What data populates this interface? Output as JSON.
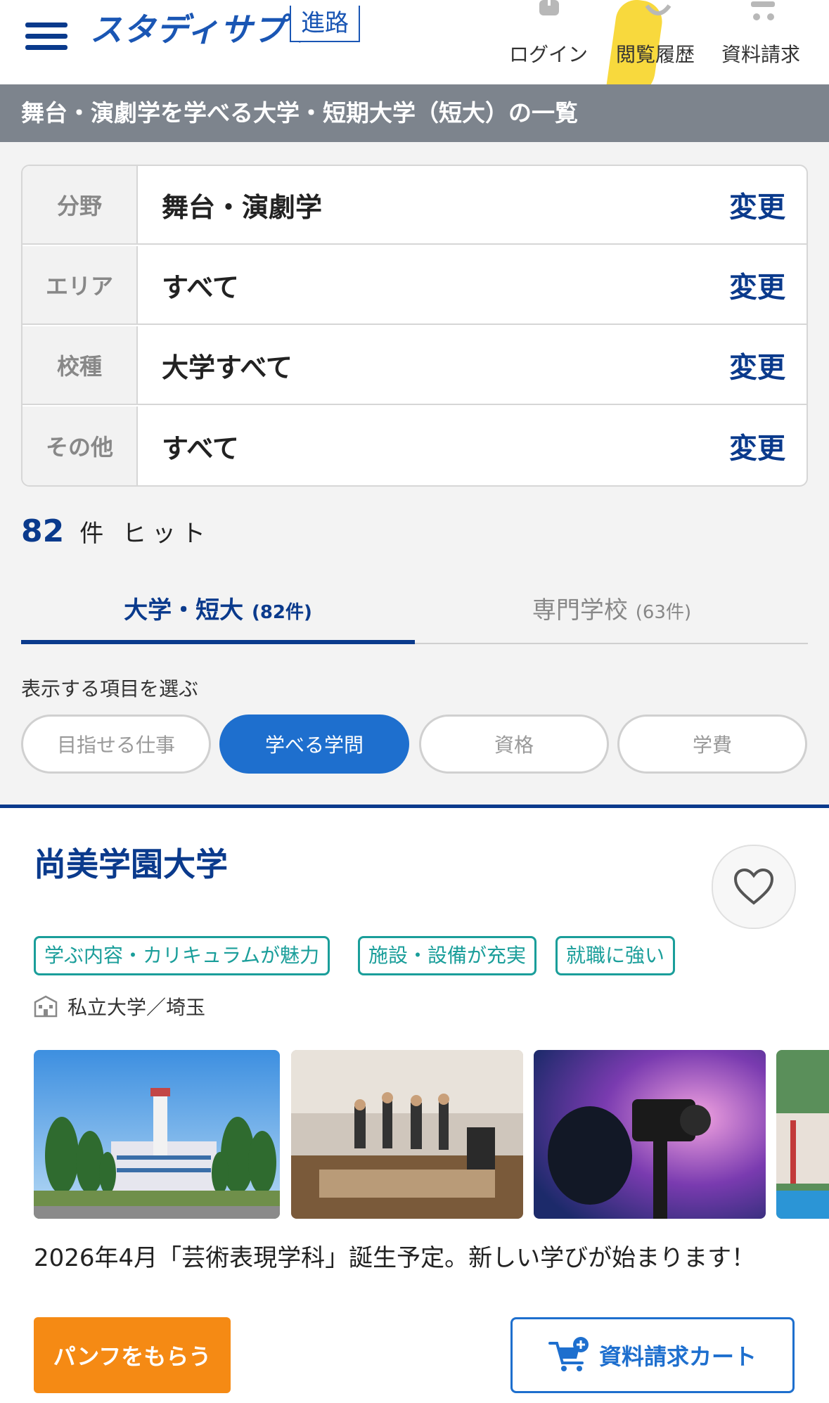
{
  "header": {
    "logo_text": "スタディサプリ",
    "logo_badge": "進路",
    "nav": [
      {
        "label": "ログイン",
        "icon": "login-icon"
      },
      {
        "label": "閲覧履歴",
        "icon": "history-icon"
      },
      {
        "label": "資料請求",
        "icon": "cart-icon"
      }
    ]
  },
  "page_title": "舞台・演劇学を学べる大学・短期大学（短大）の一覧",
  "filters": [
    {
      "key": "分野",
      "value": "舞台・演劇学",
      "action": "変更"
    },
    {
      "key": "エリア",
      "value": "すべて",
      "action": "変更"
    },
    {
      "key": "校種",
      "value": "大学すべて",
      "action": "変更"
    },
    {
      "key": "その他",
      "value": "すべて",
      "action": "変更"
    }
  ],
  "hits": {
    "count": "82",
    "unit": "件 ヒット"
  },
  "tabs": [
    {
      "label": "大学・短大",
      "count": "(82件)",
      "active": true
    },
    {
      "label": "専門学校",
      "count": "(63件)",
      "active": false
    }
  ],
  "display_select": {
    "label": "表示する項目を選ぶ",
    "options": [
      {
        "label": "目指せる仕事",
        "active": false
      },
      {
        "label": "学べる学問",
        "active": true
      },
      {
        "label": "資格",
        "active": false
      },
      {
        "label": "学費",
        "active": false
      }
    ]
  },
  "school": {
    "name": "尚美学園大学",
    "tags": [
      "学ぶ内容・カリキュラムが魅力",
      "施設・設備が充実",
      "就職に強い"
    ],
    "type": "私立大学／埼玉",
    "caption": "2026年4月「芸術表現学科」誕生予定。新しい学びが始まります！",
    "pamphlet_button": "パンフをもらう",
    "cart_button": "資料請求カート"
  },
  "colors": {
    "brand_navy": "#0a3a8c",
    "brand_blue": "#1e6fce",
    "title_bar_gray": "#7d848d",
    "tag_teal": "#1a9e9a",
    "orange": "#f58a14"
  }
}
